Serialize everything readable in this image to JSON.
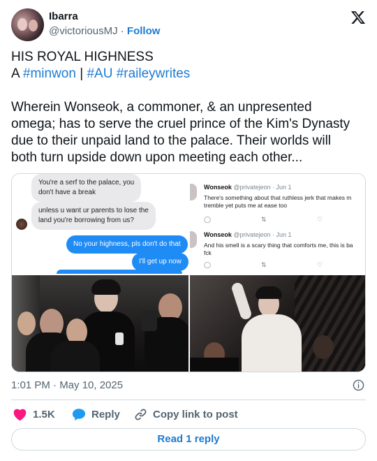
{
  "author": {
    "display_name": "Ibarra",
    "handle": "@victoriousMJ",
    "separator": "·",
    "follow_label": "Follow"
  },
  "tweet": {
    "line1": "HIS ROYAL HIGHNESS",
    "line2_prefix": "A",
    "tag_minwon": "#minwon",
    "pipe": "|",
    "tag_au": "#AU",
    "tag_raileywrites": "#raileywrites",
    "para_line1": "Wherein Wonseok, a commoner, & an unpresented",
    "para_line2": "omega; has to serve the cruel prince of the Kim's Dynasty",
    "para_line3": "due to their unpaid land to the palace. Their worlds will",
    "para_line4": "both turn upside down upon meeting each other..."
  },
  "chat": {
    "msg1_line1": "You're a serf to the palace, you",
    "msg1_line2": "don't have a break",
    "msg2_line1": "unless u want ur parents to lose the",
    "msg2_line2": "land you're borrowing from us?",
    "reply1": "No your highness, pls don't do that",
    "reply2": "I'll get up now"
  },
  "embedded_tweets": [
    {
      "name": "Wonseok",
      "meta": "@privatejeon · Jun 1",
      "line1": "There's something about that ruthless jerk that makes m",
      "line2": "tremble yet puts me at ease too"
    },
    {
      "name": "Wonseok",
      "meta": "@privatejeon · Jun 1",
      "line1": "And his smell is a scary thing that comforts me, this is ba",
      "line2": "fck"
    }
  ],
  "timestamp": "1:01 PM · May 10, 2025",
  "actions": {
    "like_count": "1.5K",
    "reply_label": "Reply",
    "copy_label": "Copy link to post"
  },
  "read_reply_label": "Read 1 reply",
  "colors": {
    "link_blue": "#1d7bd1",
    "heart_pink": "#f91880",
    "muted": "#536471",
    "bubble_blue": "#1f8bf5"
  },
  "icons": [
    "x-logo-icon",
    "info-icon",
    "heart-icon",
    "reply-bubble-icon",
    "link-icon",
    "reply-icon",
    "retweet-icon",
    "like-outline-icon"
  ]
}
